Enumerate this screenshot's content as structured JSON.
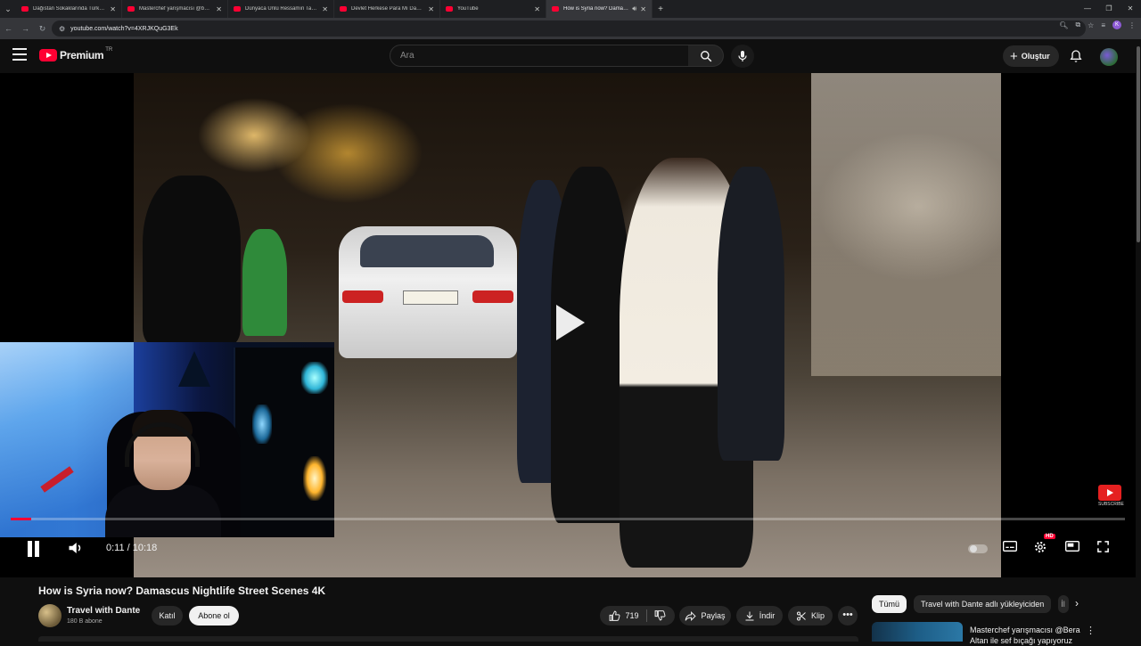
{
  "browser": {
    "tabs": [
      {
        "title": "Dağıstan Sokaklarında Türküm...",
        "active": false
      },
      {
        "title": "Masterchef yarışmacısı @bera...",
        "active": false
      },
      {
        "title": "Dünyaca Ünlü Ressamın Tablos...",
        "active": false
      },
      {
        "title": "Devlet Herkese Para Mı Dağıtıy...",
        "active": false
      },
      {
        "title": "YouTube",
        "active": false
      },
      {
        "title": "How is Syria now? Damasc...",
        "active": true
      }
    ],
    "url": "youtube.com/watch?v=4XRJKQuG3Ek"
  },
  "header": {
    "logo_text": "Premium",
    "country": "TR",
    "search_placeholder": "Ara",
    "create_label": "Oluştur"
  },
  "player": {
    "current_time": "0:11",
    "duration": "10:18",
    "progress": 0.018,
    "time_separator": " / ",
    "quality_badge": "HD",
    "watermark_text": "SUBSCRIBE"
  },
  "video": {
    "title": "How is Syria now? Damascus Nightlife Street Scenes 4K",
    "channel": "Travel with Dante",
    "subscribers": "180 B abone",
    "join_label": "Katıl",
    "subscribe_label": "Abone ol",
    "likes": "719",
    "share_label": "Paylaş",
    "download_label": "İndir",
    "clip_label": "Klip",
    "more_label": "•••"
  },
  "sidebar": {
    "chips": [
      "Tümü",
      "Travel with Dante adlı yükleyiciden",
      "İl"
    ],
    "reco_title": "Masterchef yarışmacısı @Bera Altan ile sef bıçağı yapıyoruz"
  },
  "colors": {
    "accent": "#ff0033",
    "background": "#0f0f0f"
  }
}
